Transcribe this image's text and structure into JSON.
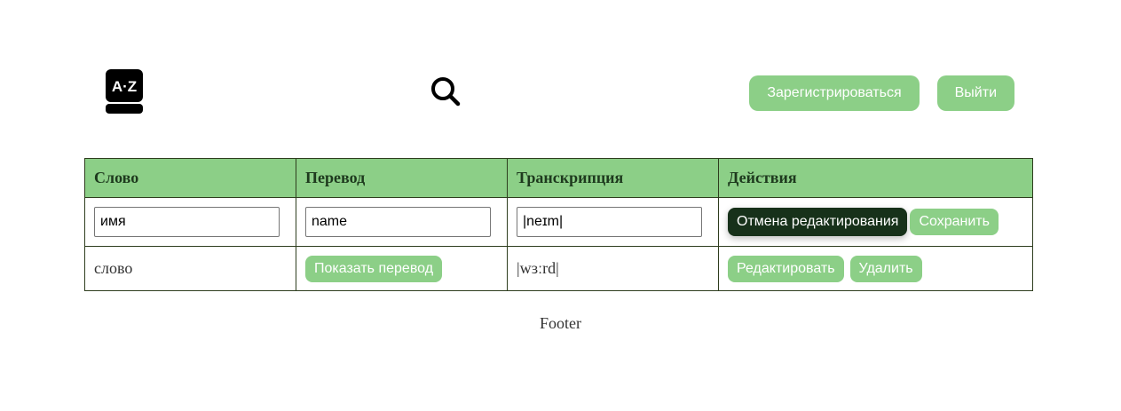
{
  "header": {
    "logo_icon": "dictionary-az-icon",
    "logo_text": "A·Z",
    "search_icon": "search-icon",
    "register_label": "Зарегистрироваться",
    "logout_label": "Выйти"
  },
  "table": {
    "columns": [
      "Слово",
      "Перевод",
      "Транскрипция",
      "Действия"
    ],
    "edit_row": {
      "word_value": "имя",
      "translation_value": "name",
      "transcription_value": "|neɪm|",
      "cancel_label": "Отмена редактирования",
      "save_label": "Сохранить"
    },
    "rows": [
      {
        "word": "слово",
        "show_translation_label": "Показать перевод",
        "transcription": "|wɜːrd|",
        "edit_label": "Редактировать",
        "delete_label": "Удалить"
      }
    ]
  },
  "footer": {
    "text": "Footer"
  },
  "colors": {
    "accent": "#8ccf87",
    "dark_button": "#17311a",
    "border": "#2e3d1e"
  }
}
